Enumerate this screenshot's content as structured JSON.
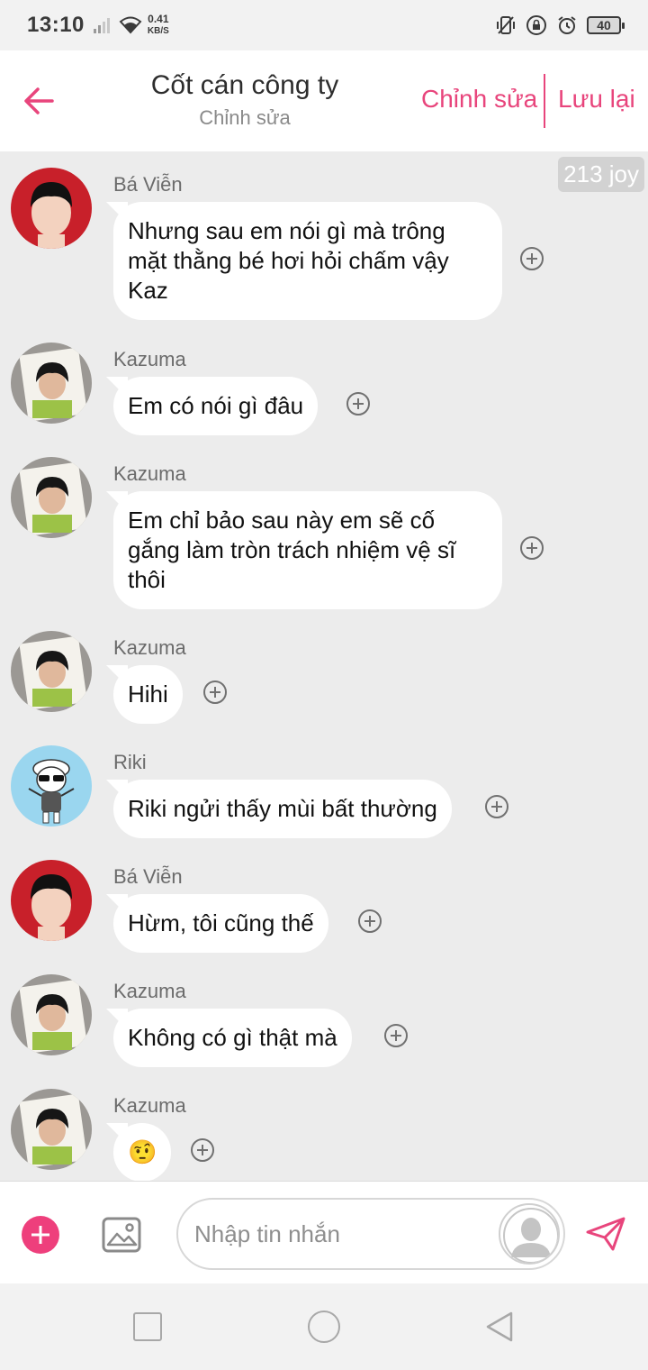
{
  "status_bar": {
    "time": "13:10",
    "net_speed_value": "0.41",
    "net_speed_unit": "KB/S",
    "battery": "40"
  },
  "header": {
    "title": "Cốt cán công ty",
    "subtitle": "Chỉnh sửa",
    "edit_label": "Chỉnh sửa",
    "save_label": "Lưu lại",
    "accent_color": "#e8457c"
  },
  "chat": {
    "joy_badge": "213 joy",
    "messages": [
      {
        "sender": "Bá Viễn",
        "text": "Nhưng sau em nói gì mà trông mặt thằng bé hơi hỏi chấm vậy Kaz",
        "avatar": "red-boy"
      },
      {
        "sender": "Kazuma",
        "text": "Em có nói gì đâu",
        "avatar": "photo-boy"
      },
      {
        "sender": "Kazuma",
        "text": "Em chỉ bảo sau này em sẽ cố gắng làm tròn trách nhiệm vệ sĩ thôi",
        "avatar": "photo-boy"
      },
      {
        "sender": "Kazuma",
        "text": "Hihi",
        "avatar": "photo-boy"
      },
      {
        "sender": "Riki",
        "text": "Riki ngửi thấy mùi bất thường",
        "avatar": "cartoon-sunglasses"
      },
      {
        "sender": "Bá Viễn",
        "text": "Hừm, tôi cũng thế",
        "avatar": "red-boy"
      },
      {
        "sender": "Kazuma",
        "text": "Không có gì thật mà",
        "avatar": "photo-boy"
      },
      {
        "sender": "Kazuma",
        "text": "🤨",
        "avatar": "photo-boy"
      }
    ]
  },
  "input_bar": {
    "placeholder": "Nhập tin nhắn",
    "accent_color": "#ee3f7c"
  }
}
